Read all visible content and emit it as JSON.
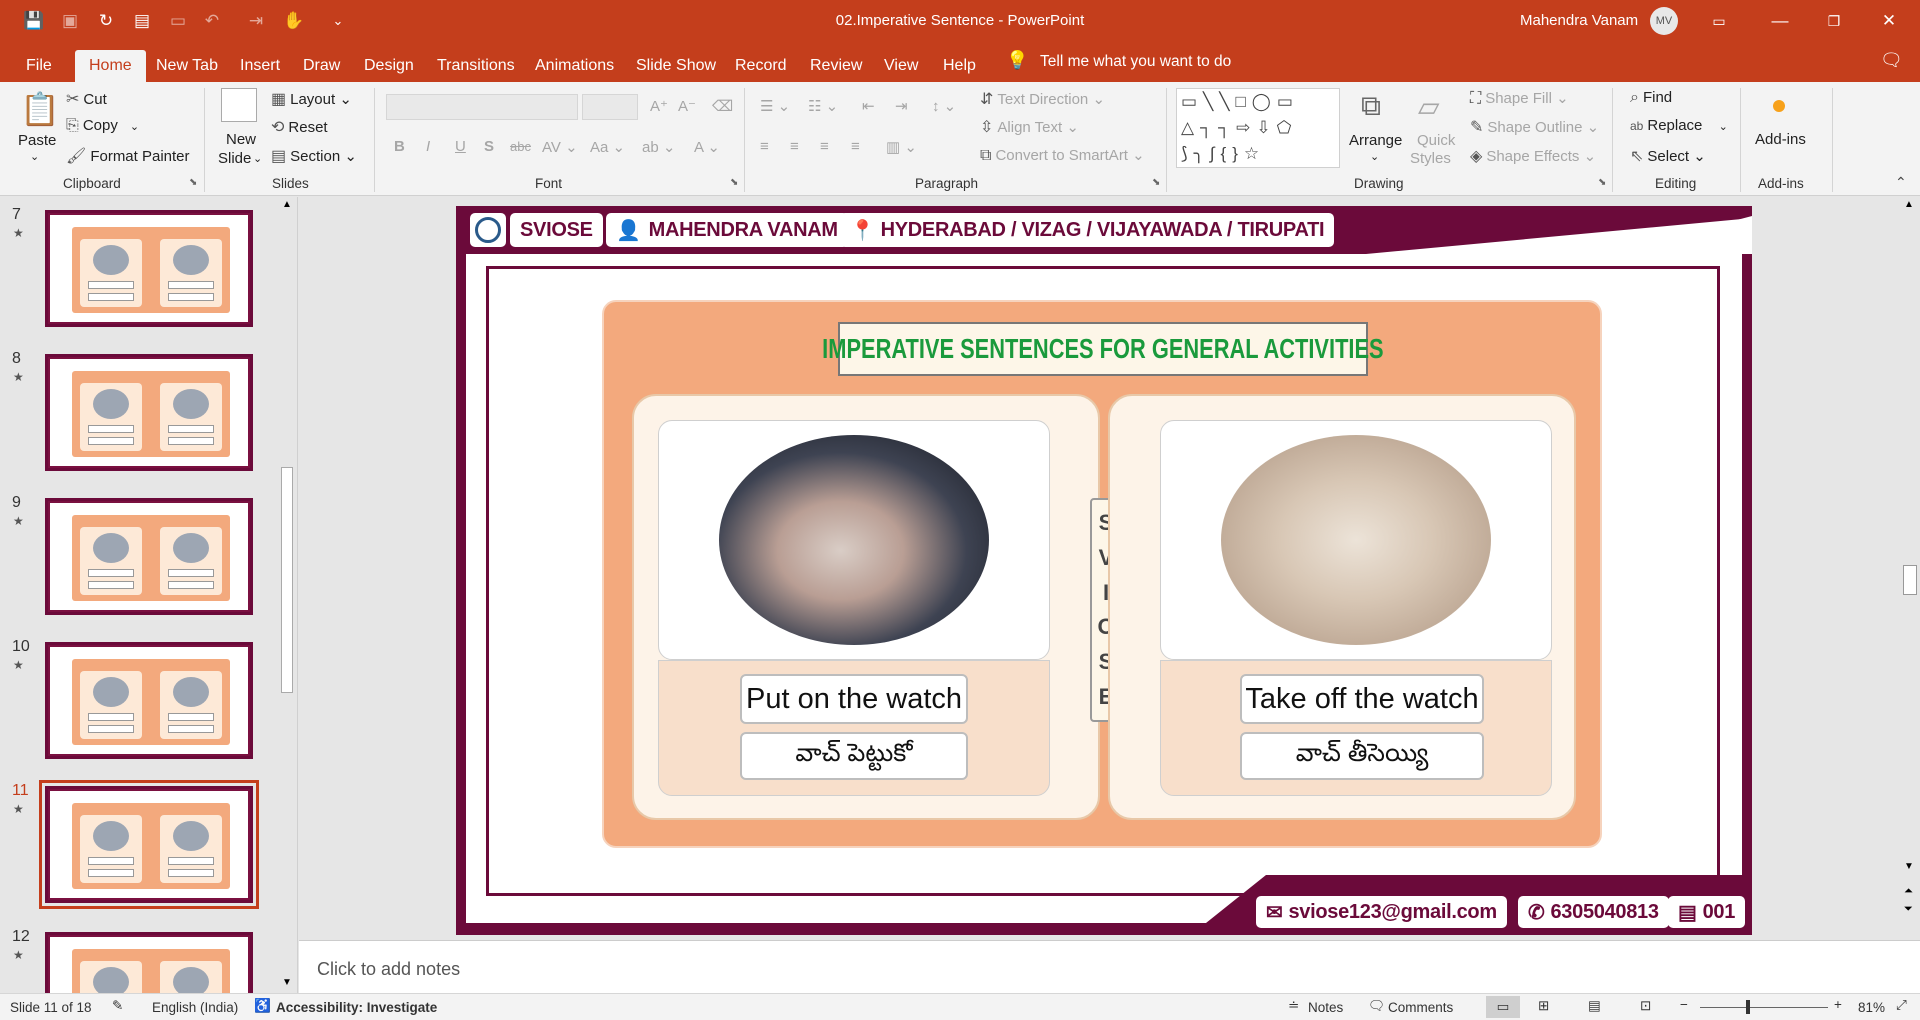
{
  "window": {
    "title": "02.Imperative Sentence  -  PowerPoint",
    "user": "Mahendra Vanam",
    "user_initials": "MV"
  },
  "tabs": [
    "File",
    "Home",
    "New Tab",
    "Insert",
    "Draw",
    "Design",
    "Transitions",
    "Animations",
    "Slide Show",
    "Record",
    "Review",
    "View",
    "Help"
  ],
  "active_tab": "Home",
  "tell_me": "Tell me what you want to do",
  "ribbon": {
    "clipboard": {
      "paste": "Paste",
      "cut": "Cut",
      "copy": "Copy",
      "format_painter": "Format Painter",
      "label": "Clipboard"
    },
    "slides": {
      "new_slide": "New",
      "new_slide2": "Slide",
      "layout": "Layout",
      "reset": "Reset",
      "section": "Section",
      "label": "Slides"
    },
    "font": {
      "label": "Font"
    },
    "paragraph": {
      "text_direction": "Text Direction",
      "align_text": "Align Text",
      "convert_smartart": "Convert to SmartArt",
      "label": "Paragraph"
    },
    "drawing": {
      "arrange": "Arrange",
      "quick_styles": "Quick",
      "quick_styles2": "Styles",
      "shape_fill": "Shape Fill",
      "shape_outline": "Shape Outline",
      "shape_effects": "Shape Effects",
      "label": "Drawing"
    },
    "editing": {
      "find": "Find",
      "replace": "Replace",
      "select": "Select",
      "label": "Editing"
    },
    "addins": {
      "button": "Add-ins",
      "label": "Add-ins"
    }
  },
  "thumbnails": [
    {
      "num": "7",
      "star": "★"
    },
    {
      "num": "8",
      "star": "★"
    },
    {
      "num": "9",
      "star": "★"
    },
    {
      "num": "10",
      "star": "★"
    },
    {
      "num": "11",
      "star": "★"
    },
    {
      "num": "12",
      "star": "★"
    }
  ],
  "selected_slide": "11",
  "slide": {
    "header": {
      "brand": "SVIOSE",
      "name": "MAHENDRA VANAM",
      "location": "HYDERABAD / VIZAG / VIJAYAWADA / TIRUPATI"
    },
    "title": "IMPERATIVE SENTENCES FOR GENERAL ACTIVITIES",
    "left": {
      "english": "Put on the watch",
      "telugu": "వాచ్ పెట్టుకో"
    },
    "right": {
      "english": "Take off the watch",
      "telugu": "వాచ్ తీసెయ్యి"
    },
    "divider_letters": [
      "S",
      "V",
      "I",
      "O",
      "S",
      "E"
    ],
    "footer": {
      "email": "sviose123@gmail.com",
      "phone": "6305040813",
      "page": "001"
    }
  },
  "notes_placeholder": "Click to add notes",
  "status": {
    "slide_info": "Slide 11 of 18",
    "language": "English (India)",
    "accessibility": "Accessibility: Investigate",
    "notes": "Notes",
    "comments": "Comments",
    "zoom": "81%"
  },
  "colors": {
    "accent": "#c43e1c",
    "slide_frame": "#6b0a3a",
    "panel": "#f3a97d",
    "title_green": "#1a9a3c"
  }
}
